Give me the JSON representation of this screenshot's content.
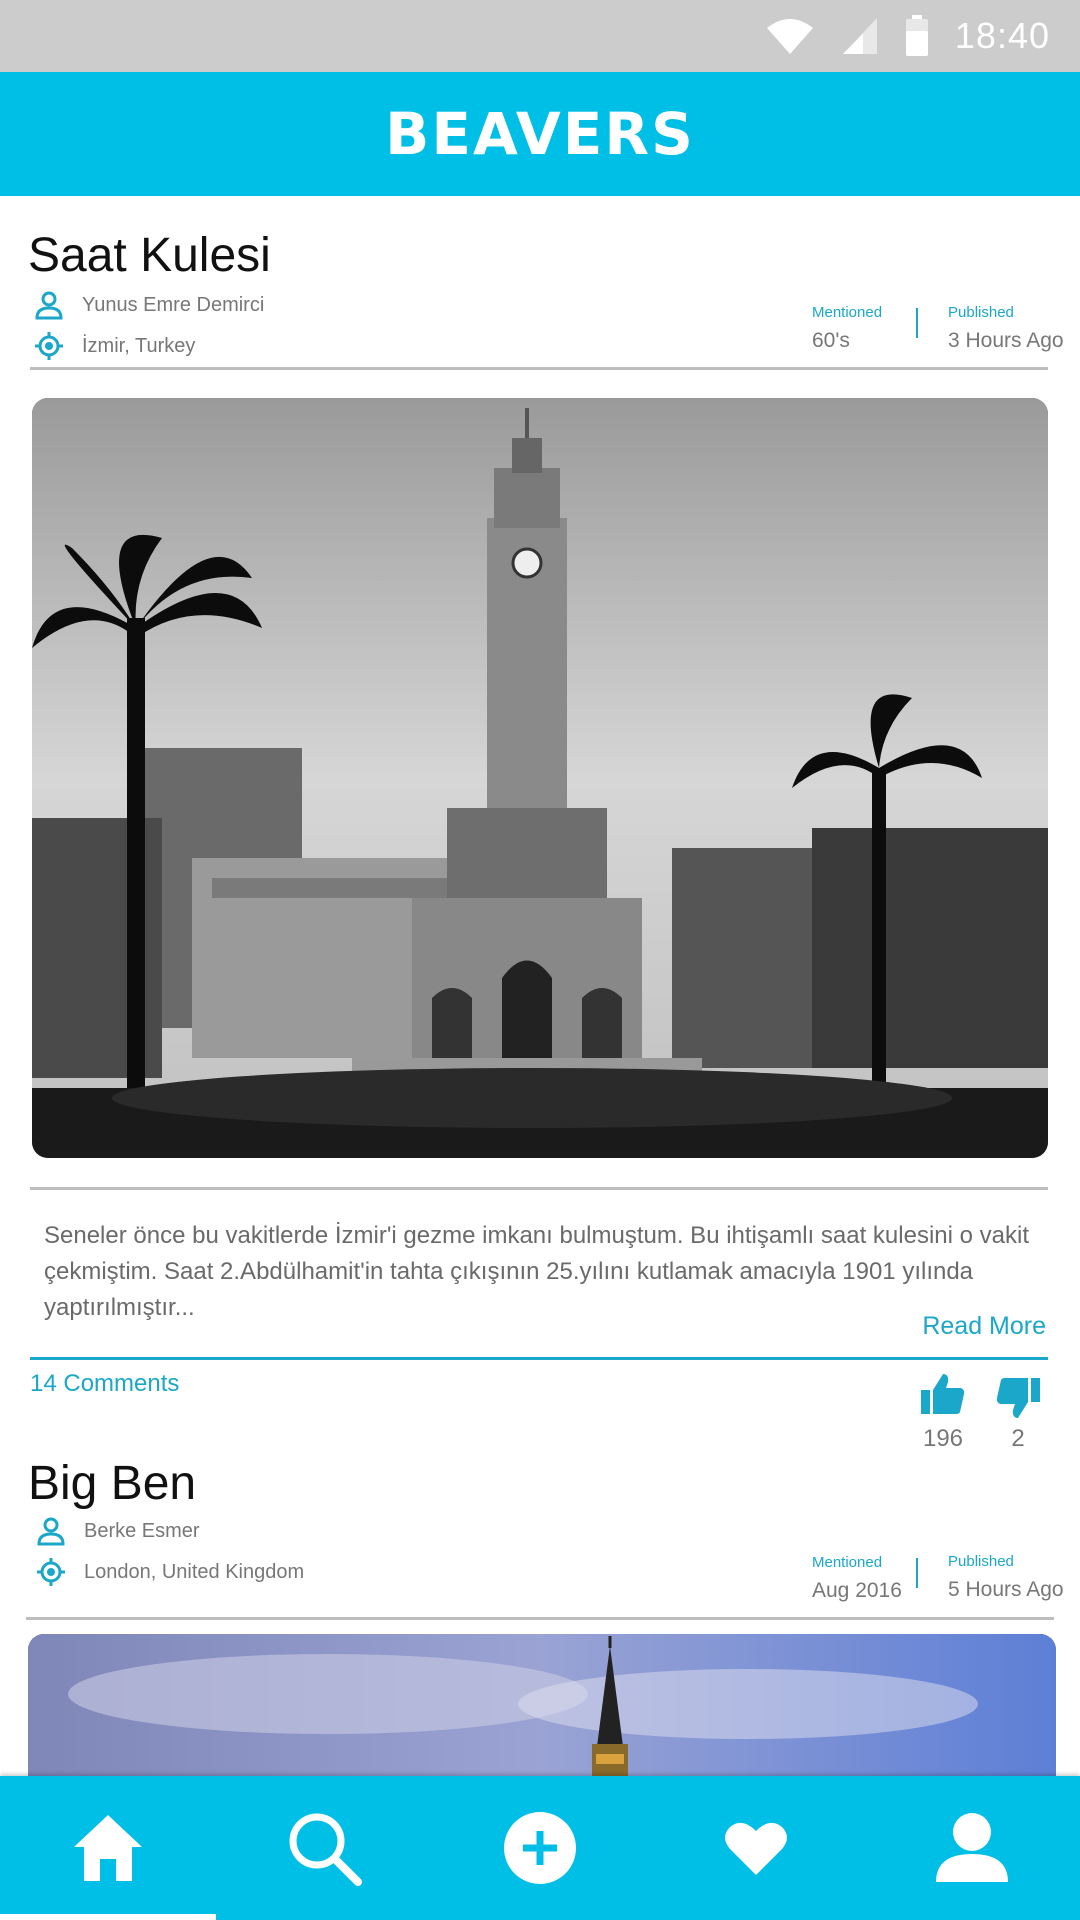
{
  "status_bar": {
    "time": "18:40",
    "icons": [
      "wifi-icon",
      "signal-icon",
      "battery-icon"
    ]
  },
  "app": {
    "title": "BEAVERS"
  },
  "colors": {
    "primary": "#00BFE6",
    "accent": "#1aa7c9"
  },
  "posts": [
    {
      "title": "Saat Kulesi",
      "author": "Yunus Emre Demirci",
      "location": "İzmir, Turkey",
      "mentioned_label": "Mentioned",
      "mentioned_value": "60's",
      "published_label": "Published",
      "published_value": "3 Hours Ago",
      "excerpt_line1": "Seneler önce bu vakitlerde İzmir'i gezme imkanı bulmuştum. Bu ihtişamlı saat kulesini o vakit",
      "excerpt_line2": "çekmiştim. Saat 2.Abdülhamit'in tahta çıkışının 25.yılını kutlamak amacıyla 1901 yılında yaptırılmıştır...",
      "read_more": "Read More",
      "comments": "14 Comments",
      "likes": "196",
      "dislikes": "2"
    },
    {
      "title": "Big Ben",
      "author": "Berke Esmer",
      "location": "London, United Kingdom",
      "mentioned_label": "Mentioned",
      "mentioned_value": "Aug 2016",
      "published_label": "Published",
      "published_value": "5 Hours Ago"
    }
  ],
  "bottom_nav": {
    "items": [
      "home-icon",
      "search-icon",
      "add-icon",
      "heart-icon",
      "profile-icon"
    ],
    "active": "home-icon"
  }
}
